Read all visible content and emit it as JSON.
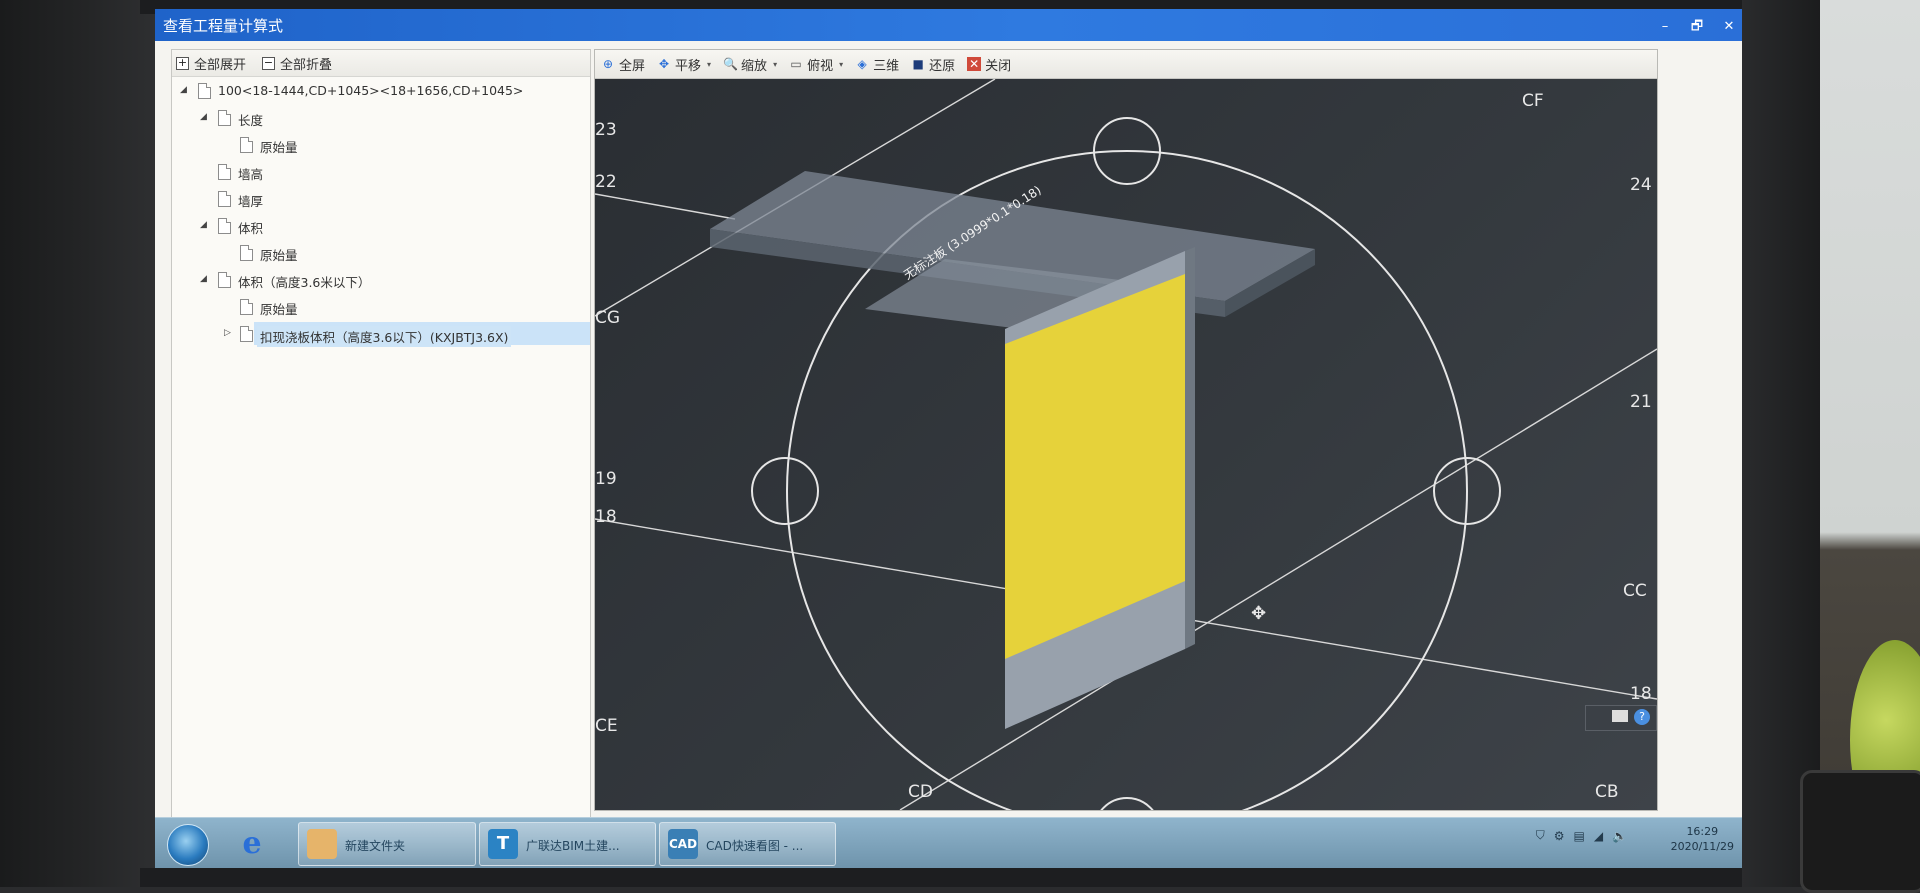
{
  "window": {
    "title": "查看工程量计算式",
    "controls": [
      "–",
      "🗗",
      "✕"
    ]
  },
  "left_toolbar": {
    "expand_all": "全部展开",
    "collapse_all": "全部折叠"
  },
  "tree": [
    {
      "label": "100<18-1444,CD+1045><18+1656,CD+1045>",
      "level": 0,
      "arrow": "◢"
    },
    {
      "label": "长度",
      "level": 1,
      "arrow": "◢"
    },
    {
      "label": "原始量",
      "level": 2,
      "arrow": ""
    },
    {
      "label": "墙高",
      "level": 1,
      "arrow": ""
    },
    {
      "label": "墙厚",
      "level": 1,
      "arrow": ""
    },
    {
      "label": "体积",
      "level": 1,
      "arrow": "◢"
    },
    {
      "label": "原始量",
      "level": 2,
      "arrow": ""
    },
    {
      "label": "体积（高度3.6米以下）",
      "level": 1,
      "arrow": "◢"
    },
    {
      "label": "原始量",
      "level": 2,
      "arrow": ""
    },
    {
      "label": "扣现浇板体积（高度3.6以下）(KXJBTJ3.6X)",
      "level": 2,
      "arrow": "▷",
      "selected": true
    }
  ],
  "right_toolbar": {
    "fullscreen": "全屏",
    "pan": "平移",
    "zoom": "缩放",
    "top_view": "俯视",
    "three_d": "三维",
    "restore": "还原",
    "close": "关闭"
  },
  "viewport": {
    "slab_label": "无标注板 (3.0999*0.1*0.18)",
    "axis_labels": {
      "CF": "CF",
      "CG": "CG",
      "CE": "CE",
      "CD": "CD",
      "CB": "CB",
      "CC": "CC",
      "n23": "23",
      "n22": "22",
      "n19": "19",
      "n18a": "18",
      "n24": "24",
      "n21": "21",
      "n18b": "18"
    },
    "wall_color": "#e6d23a"
  },
  "taskbar": {
    "items": [
      {
        "label": "新建文件夹",
        "icon_color": "#e6b46a",
        "icon_text": ""
      },
      {
        "label": "广联达BIM土建...",
        "icon_color": "#2b83c4",
        "icon_text": "T"
      },
      {
        "label": "CAD快速看图 - ...",
        "icon_color": "#3a7fb5",
        "icon_text": "CAD"
      }
    ],
    "time": "16:29",
    "date": "2020/11/29"
  }
}
